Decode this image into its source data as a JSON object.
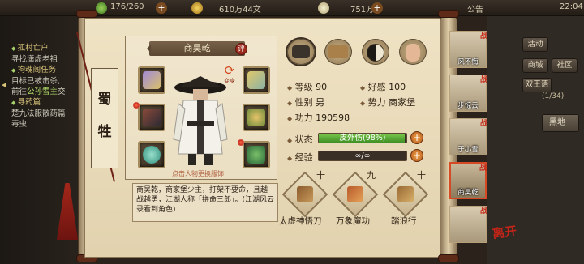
{
  "topbar": {
    "stamina": "176/260",
    "copper": "610万44文",
    "silver": "751万",
    "announcement": "公告",
    "time": "22:04"
  },
  "quests": [
    {
      "title": "孤村亡户",
      "desc": "寻找潇虚老祖"
    },
    {
      "title": "拘魂阁任务",
      "desc": "目标已被击杀,",
      "desc2_pre": "前往",
      "desc2_hl": "公孙雪主",
      "desc2_post": "交"
    },
    {
      "title": "寻药篇",
      "desc": "楚九法服散药篇",
      "desc2_pre": "毒虫",
      "desc2_hl": "",
      "desc2_post": ""
    }
  ],
  "right_menu": {
    "activity": "活动",
    "shop": "商城",
    "social": "社区",
    "ranking": "双王语",
    "ranking_count": "(1/34)",
    "map": "黑地"
  },
  "character": {
    "name": "商昊乾",
    "ping_label": "评",
    "clan_name": "蜀牲",
    "transform_label": "变身",
    "click_hint": "点击人物更换服饰",
    "bio": "商昊乾，商家堡少主，打架不要命，且越战越勇，江湖人称「拼命三郎」。(江湖风云录看到角色)"
  },
  "stats": {
    "level_label": "等级",
    "level": "90",
    "favor_label": "好感",
    "favor": "100",
    "gender_label": "性别",
    "gender": "男",
    "faction_label": "势力",
    "faction": "商家堡",
    "power_label": "功力",
    "power": "190598",
    "status_label": "状态",
    "status_text": "皮外伤(98%)",
    "status_fill": 0.98,
    "exp_label": "经验",
    "exp_text": "∞/∞",
    "exp_fill": 0
  },
  "skills": [
    {
      "name": "太虚神悟刀",
      "level": "十"
    },
    {
      "name": "万象魔功",
      "level": "九"
    },
    {
      "name": "踏浪行",
      "level": "十"
    }
  ],
  "roster": [
    {
      "name": "风不悔",
      "tag": "战"
    },
    {
      "name": "步惊云",
      "tag": "战"
    },
    {
      "name": "于小雪",
      "tag": "战"
    },
    {
      "name": "商昊乾",
      "tag": "战"
    },
    {
      "name": "",
      "tag": "战"
    }
  ],
  "seal": "离开"
}
